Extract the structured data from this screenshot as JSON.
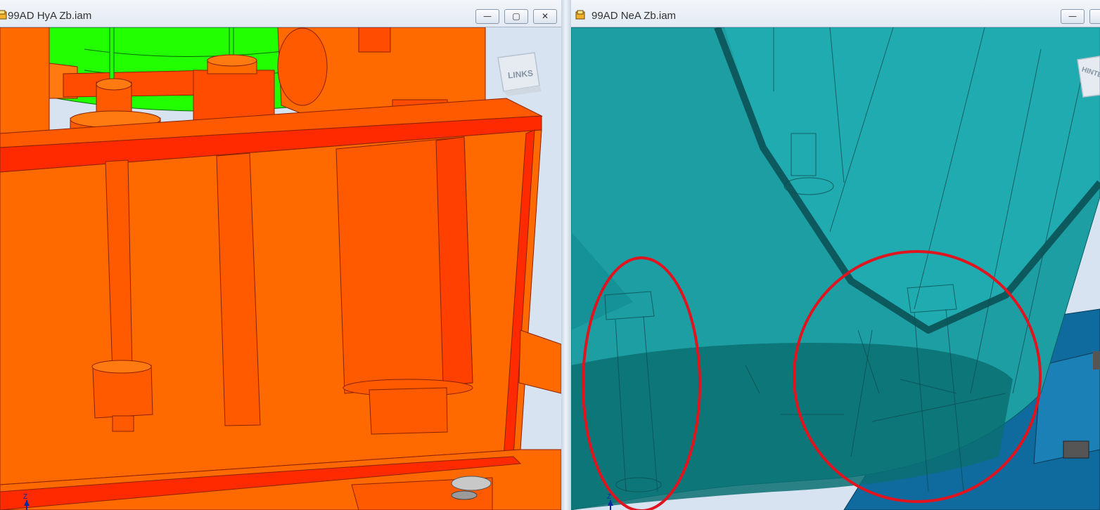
{
  "left_window": {
    "title": "99AD HyA Zb.iam",
    "viewcube_label": "LINKS",
    "axis_label": "Z",
    "controls": {
      "minimize": "—",
      "maximize": "▢",
      "close": "✕"
    }
  },
  "right_window": {
    "title": "99AD NeA Zb.iam",
    "viewcube_label": "HINTEN",
    "axis_label": "Z",
    "controls": {
      "minimize": "—"
    }
  },
  "colors": {
    "title_bar": "#e8eef6",
    "orange_model": "#ff6a00",
    "red_edges": "#ff2a00",
    "green_part": "#22ff00",
    "teal_model": "#1c9ea3",
    "dark_teal": "#0a6e72",
    "blue_base": "#0f6a9e",
    "annotation_red": "#e0141e"
  },
  "annotations": [
    "red-ellipse-left",
    "red-circle-right"
  ]
}
